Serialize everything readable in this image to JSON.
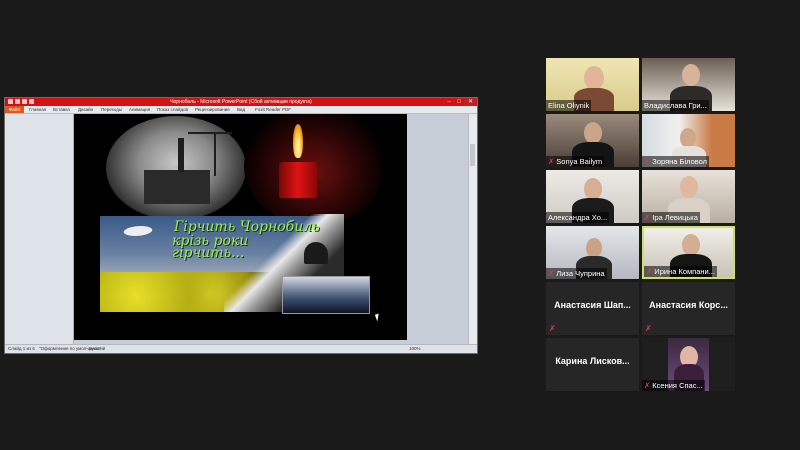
{
  "powerpoint": {
    "window_title": "Чорнобиль - Microsoft PowerPoint (Сбой активации продукта)",
    "ribbon_tabs": [
      "Файл",
      "Главная",
      "Вставка",
      "Дизайн",
      "Переходы",
      "Анимация",
      "Показ слайдов",
      "Рецензирование",
      "Вид",
      "Foxit Reader PDF"
    ],
    "slide_text": [
      "Гірчить Чорнобиль",
      "крізь роки",
      "гірчить..."
    ],
    "status": {
      "slide_count": "Слайд 1 из 6",
      "theme": "\"Оформление по умолчанию\"",
      "language": "русский",
      "zoom": "100%"
    }
  },
  "participants": [
    {
      "name": "Elina Oliynik",
      "muted": false,
      "video": true
    },
    {
      "name": "Владислава Гри...",
      "muted": false,
      "video": true
    },
    {
      "name": "Sonya Bailym",
      "muted": true,
      "video": true
    },
    {
      "name": "Зоряна Біловол",
      "muted": true,
      "video": true
    },
    {
      "name": "Александра Хо...",
      "muted": false,
      "video": true
    },
    {
      "name": "Іра Левицька",
      "muted": true,
      "video": true
    },
    {
      "name": "Лиза Чуприна",
      "muted": true,
      "video": true
    },
    {
      "name": "Ирина Компани...",
      "muted": true,
      "video": true,
      "active": true
    },
    {
      "name": "Анастасия Шап...",
      "muted": true,
      "video": false
    },
    {
      "name": "Анастасия Корс...",
      "muted": true,
      "video": false
    },
    {
      "name": "Карина Лисков...",
      "muted": false,
      "video": false
    },
    {
      "name": "Ксения Спас...",
      "muted": true,
      "video": true
    }
  ]
}
